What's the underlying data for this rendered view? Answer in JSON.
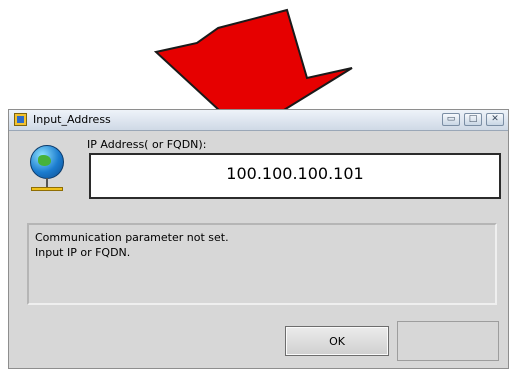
{
  "window": {
    "title": "Input_Address"
  },
  "titlebar_buttons": {
    "minimize": "▭",
    "maximize": "□",
    "close": "✕"
  },
  "form": {
    "label": "IP Address( or FQDN):",
    "ip_value": "100.100.100.101"
  },
  "message": {
    "line1": "Communication parameter not set.",
    "line2": "Input IP or FQDN."
  },
  "buttons": {
    "ok": "OK"
  },
  "colors": {
    "arrow": "#e60000",
    "arrow_outline": "#1a1a1a"
  }
}
